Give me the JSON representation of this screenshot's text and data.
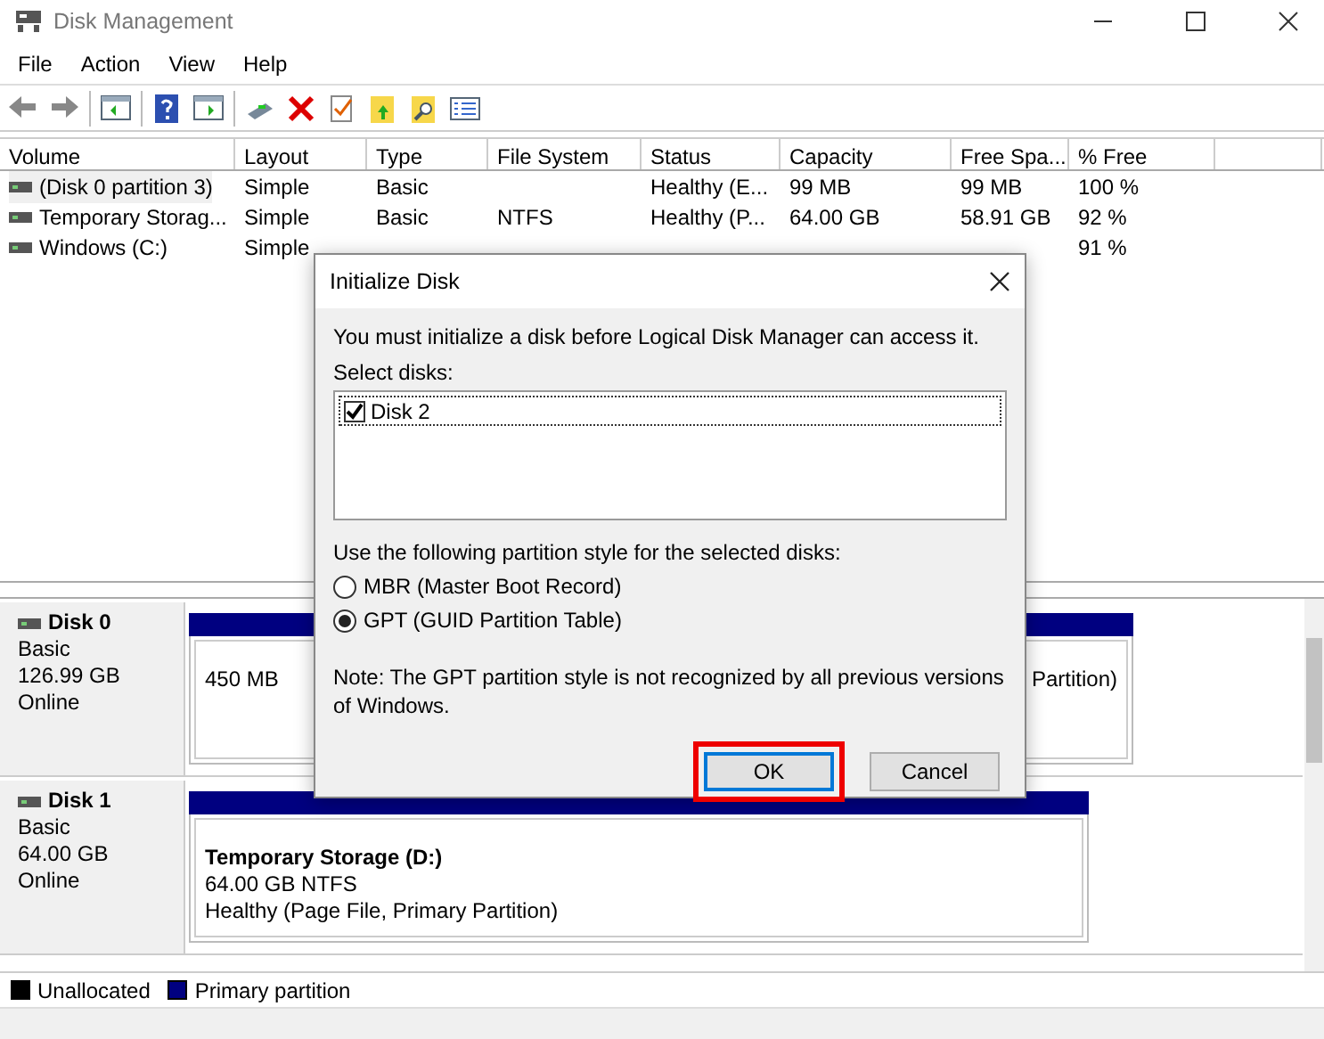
{
  "window": {
    "title": "Disk Management"
  },
  "menu": [
    "File",
    "Action",
    "View",
    "Help"
  ],
  "volumes": {
    "columns": [
      "Volume",
      "Layout",
      "Type",
      "File System",
      "Status",
      "Capacity",
      "Free Spa...",
      "% Free"
    ],
    "rows": [
      {
        "cells": [
          "(Disk 0 partition 3)",
          "Simple",
          "Basic",
          "",
          "Healthy (E...",
          "99 MB",
          "99 MB",
          "100 %"
        ],
        "selected": true
      },
      {
        "cells": [
          "Temporary Storag...",
          "Simple",
          "Basic",
          "NTFS",
          "Healthy (P...",
          "64.00 GB",
          "58.91 GB",
          "92 %"
        ],
        "selected": false
      },
      {
        "cells": [
          "Windows (C:)",
          "Simple",
          null,
          null,
          null,
          null,
          null,
          "91 %"
        ],
        "selected": false
      }
    ]
  },
  "disks": [
    {
      "name": "Disk 0",
      "type": "Basic",
      "size": "126.99 GB",
      "status": "Online",
      "partitions": [
        {
          "lines": [
            "450 MB"
          ]
        },
        {
          "lines": [
            "Partition)"
          ]
        }
      ]
    },
    {
      "name": "Disk 1",
      "type": "Basic",
      "size": "64.00 GB",
      "status": "Online",
      "partitions": [
        {
          "title": "Temporary Storage  (D:)",
          "lines": [
            "64.00 GB NTFS",
            "Healthy (Page File, Primary Partition)"
          ]
        }
      ]
    }
  ],
  "legend": [
    {
      "label": "Unallocated",
      "color": "#000000"
    },
    {
      "label": "Primary partition",
      "color": "#000080"
    }
  ],
  "dialog": {
    "title": "Initialize Disk",
    "message": "You must initialize a disk before Logical Disk Manager can access it.",
    "select_label": "Select disks:",
    "disks": [
      {
        "label": "Disk 2",
        "checked": true
      }
    ],
    "style_label": "Use the following partition style for the selected disks:",
    "styles": [
      {
        "label": "MBR (Master Boot Record)",
        "selected": false
      },
      {
        "label": "GPT (GUID Partition Table)",
        "selected": true
      }
    ],
    "note": "Note: The GPT partition style is not recognized by all previous versions of Windows.",
    "buttons": [
      {
        "label": "OK",
        "default": true,
        "highlighted": true
      },
      {
        "label": "Cancel",
        "default": false,
        "highlighted": false
      }
    ]
  }
}
